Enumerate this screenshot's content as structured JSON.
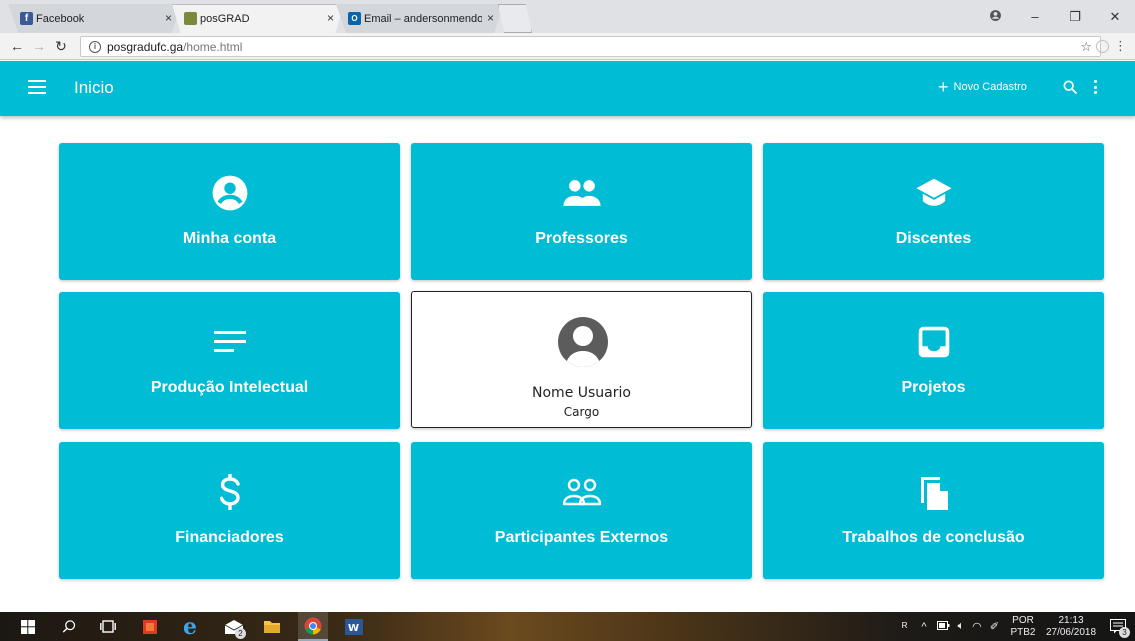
{
  "browser": {
    "tabs": [
      {
        "title": "Facebook",
        "favicon_color": "#3b5998",
        "active": false
      },
      {
        "title": "posGRAD",
        "favicon_color": "#7a8a3a",
        "active": true
      },
      {
        "title": "Email – andersonmendon",
        "favicon_color": "#0a64ad",
        "active": false
      }
    ],
    "close_glyph": "×",
    "url_host": "posgradufc.ga",
    "url_path": "/home.html",
    "window_controls": [
      "–",
      "❐",
      "✕"
    ]
  },
  "app": {
    "title": "Inicio",
    "new_button_label": "Novo Cadastro",
    "accent_color": "#00bcd4"
  },
  "cards": [
    {
      "label": "Minha conta",
      "icon": "account-circle-icon"
    },
    {
      "label": "Professores",
      "icon": "people-icon"
    },
    {
      "label": "Discentes",
      "icon": "school-icon"
    },
    {
      "label": "Produção Intelectual",
      "icon": "notes-icon"
    },
    {
      "label": "Projetos",
      "icon": "inbox-icon"
    },
    {
      "label": "Financiadores",
      "icon": "dollar-icon"
    },
    {
      "label": "Participantes Externos",
      "icon": "people-outline-icon"
    },
    {
      "label": "Trabalhos de conclusão",
      "icon": "file-copy-icon"
    }
  ],
  "user_card": {
    "name": "Nome Usuario",
    "role": "Cargo"
  },
  "taskbar": {
    "language_top": "POR",
    "language_bottom": "PTB2",
    "time": "21:13",
    "date": "27/06/2018",
    "notification_count": "3",
    "mail_badge": "2"
  }
}
